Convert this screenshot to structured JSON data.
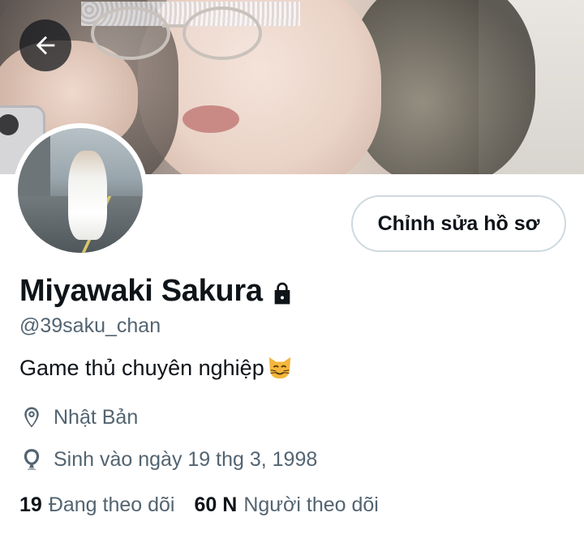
{
  "header": {
    "back_icon": "arrow-left-icon"
  },
  "profile": {
    "name": "Miyawaki Sakura",
    "protected_icon": "lock-icon",
    "handle": "@39saku_chan",
    "bio": "Game thủ chuyên nghiệp",
    "bio_emoji": "cat-face-emoji",
    "location": "Nhật Bản",
    "location_icon": "location-pin-icon",
    "birthday": "Sinh vào ngày 19 thg 3, 1998",
    "birthday_icon": "balloon-icon",
    "following_count": "19",
    "following_label": "Đang theo dõi",
    "followers_count": "60 N",
    "followers_label": "Người theo dõi"
  },
  "actions": {
    "edit_profile": "Chỉnh sửa hồ sơ"
  },
  "colors": {
    "text": "#0f1419",
    "secondary": "#536471",
    "border": "#cfd9de"
  }
}
